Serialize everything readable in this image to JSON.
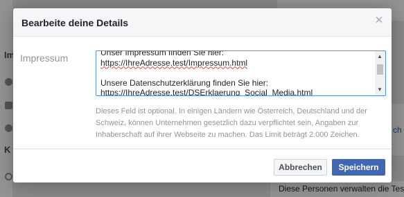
{
  "background": {
    "frag_im": "Im",
    "frag_k": "K",
    "frag_ch": "ch",
    "frag_verwalten": "Diese Personen verwalten die Tes"
  },
  "dialog": {
    "title": "Bearbeite deine Details",
    "close_symbol": "✕",
    "field_label": "Impressum",
    "textarea_lines": {
      "line1": "Unser Impressum finden Sie hier:",
      "line2": "https://IhreAdresse.test/Impressum.html",
      "line3": "",
      "line4": "Unsere Datenschutzerklärung finden Sie hier:",
      "line5": "https://IhreAdresse.test/DSErklaerung_Social_Media.html"
    },
    "help_text": "Dieses Feld ist optional. In einigen Ländern wie Österreich, Deutschland und der Schweiz, können Unternehmen gesetzlich dazu verpflichtet sein, Angaben zur Inhaberschaft auf ihrer Webseite zu machen. Das Limit beträgt 2.000 Zeichen.",
    "cancel_label": "Abbrechen",
    "save_label": "Speichern"
  },
  "colors": {
    "primary": "#4267b2",
    "focus_border": "#4d90fe",
    "muted_text": "#90949c"
  }
}
